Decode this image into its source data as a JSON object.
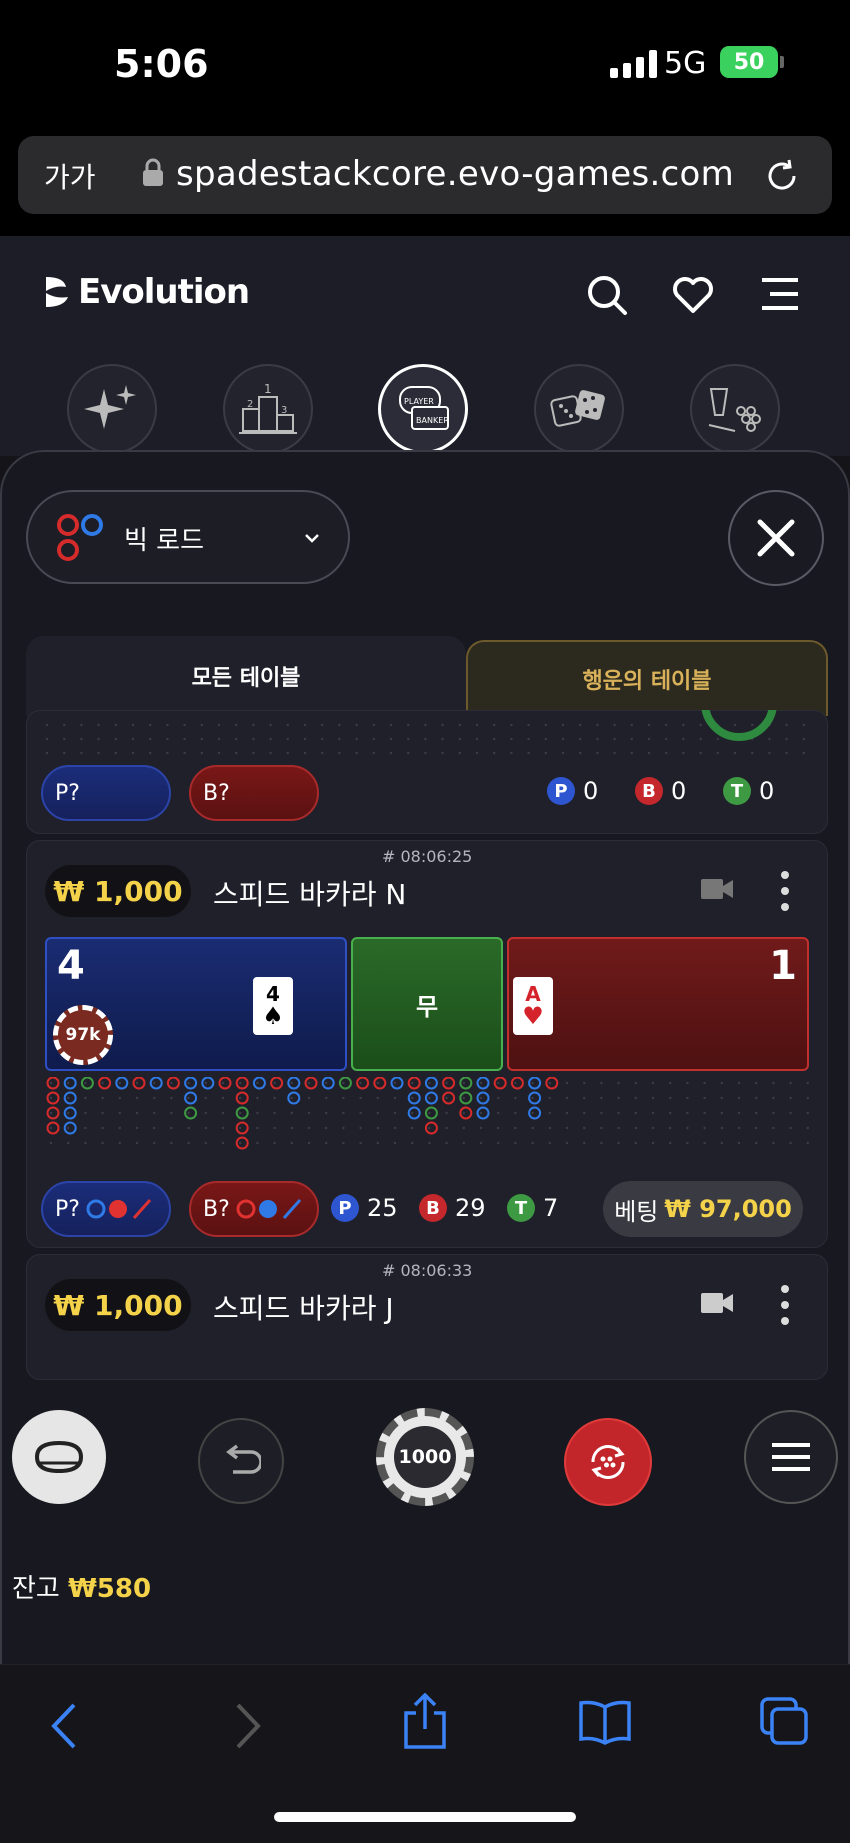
{
  "status": {
    "time": "5:06",
    "network": "5G",
    "battery": "50"
  },
  "browser": {
    "text_size": "가가",
    "url": "spadestackcore.evo-games.com"
  },
  "header": {
    "logo": "Evolution"
  },
  "road_selector": {
    "label": "빅 로드"
  },
  "tabs": {
    "all": "모든 테이블",
    "lucky": "행운의 테이블"
  },
  "card_top": {
    "p_pill": "P?",
    "b_pill": "B?",
    "p_count": "0",
    "b_count": "0",
    "t_count": "0"
  },
  "table_n": {
    "hash": "# 08:06:25",
    "min_bet": "₩ 1,000",
    "name": "스피드 바카라 N",
    "player_score": "4",
    "tie_label": "무",
    "banker_score": "1",
    "player_card_rank": "4",
    "player_card_suit": "♠",
    "banker_card_rank": "A",
    "banker_card_suit": "♥",
    "chip_label": "97k",
    "p_pill": "P?",
    "b_pill": "B?",
    "p_count": "25",
    "b_count": "29",
    "t_count": "7",
    "bet_label": "베팅",
    "bet_amount": "₩ 97,000"
  },
  "table_j": {
    "hash": "# 08:06:33",
    "min_bet": "₩ 1,000",
    "name": "스피드 바카라 J"
  },
  "controls": {
    "chip_value": "1000"
  },
  "balance": {
    "label": "잔고",
    "amount": "₩580"
  },
  "colors": {
    "accent_gold": "#f4d34a",
    "player_blue": "#2e56d1",
    "banker_red": "#c5282c",
    "tie_green": "#3d9a42"
  }
}
